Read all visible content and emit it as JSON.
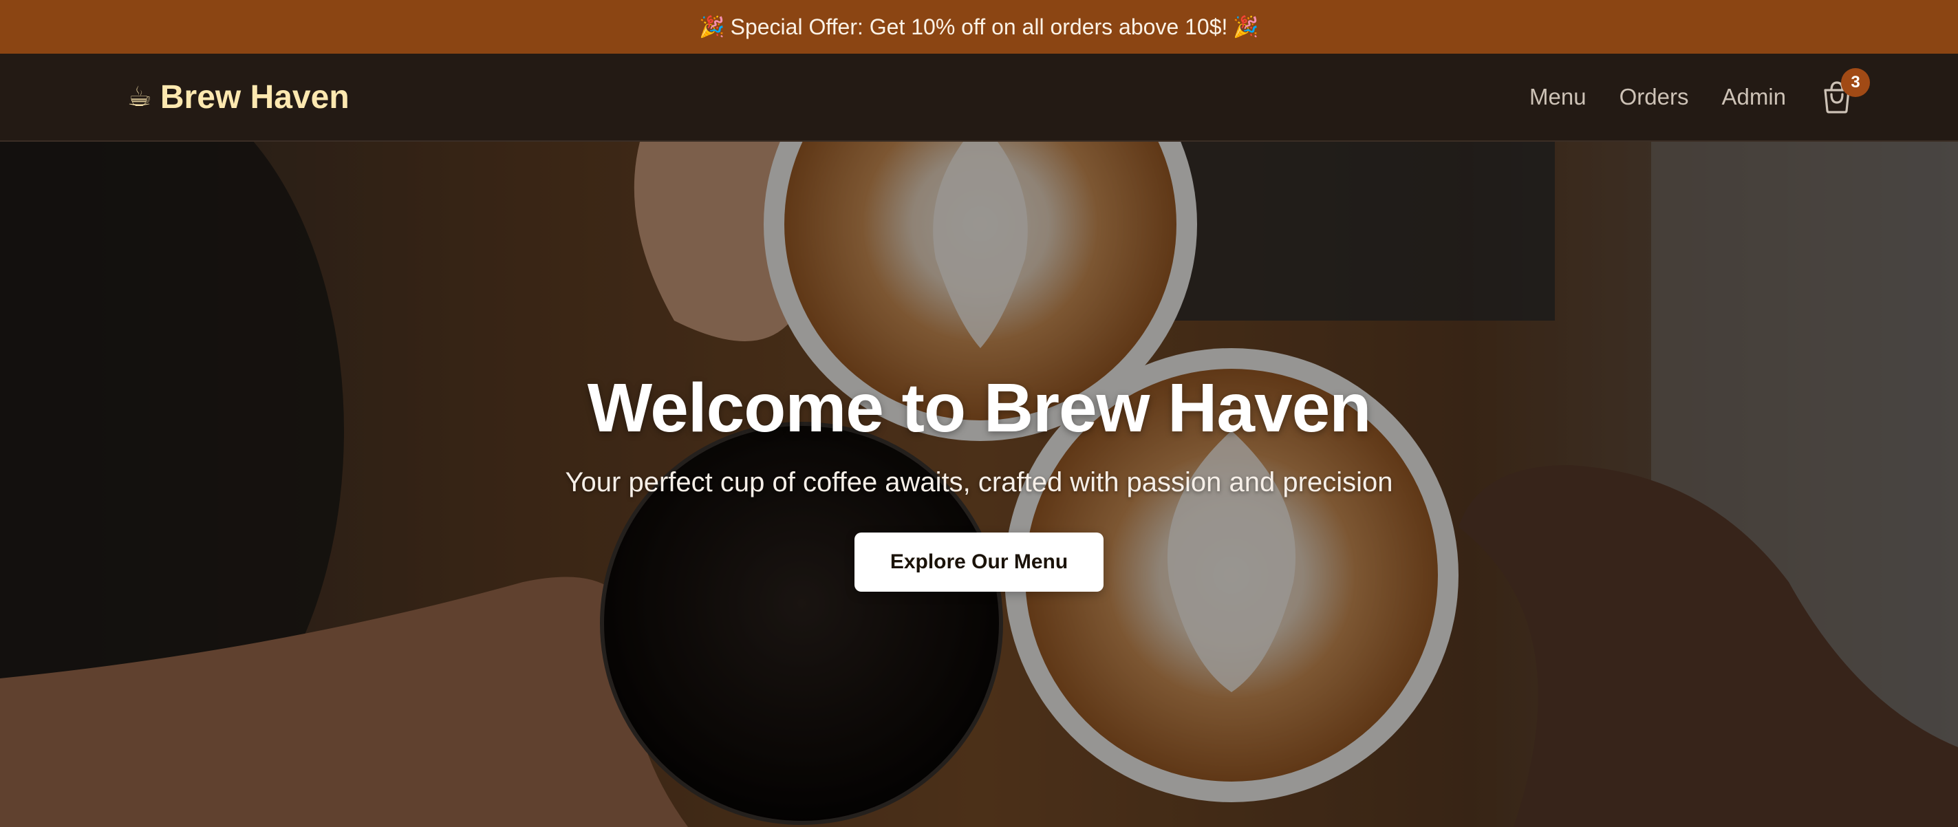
{
  "promo": {
    "prefix_emoji": "🎉",
    "text": "Special Offer: Get 10% off on all orders above 10$!",
    "suffix_emoji": "🎉"
  },
  "brand": {
    "icon": "☕",
    "name": "Brew Haven"
  },
  "nav": {
    "links": [
      "Menu",
      "Orders",
      "Admin"
    ],
    "cart_icon": "shopping-bag-icon",
    "cart_count": "3"
  },
  "hero": {
    "title": "Welcome to Brew Haven",
    "subtitle": "Your perfect cup of coffee awaits, crafted with passion and precision",
    "cta_label": "Explore Our Menu"
  },
  "colors": {
    "promo_bg": "#8b4513",
    "nav_bg": "#231a14",
    "brand_text": "#fde8b0",
    "badge_bg": "#a14a15"
  }
}
